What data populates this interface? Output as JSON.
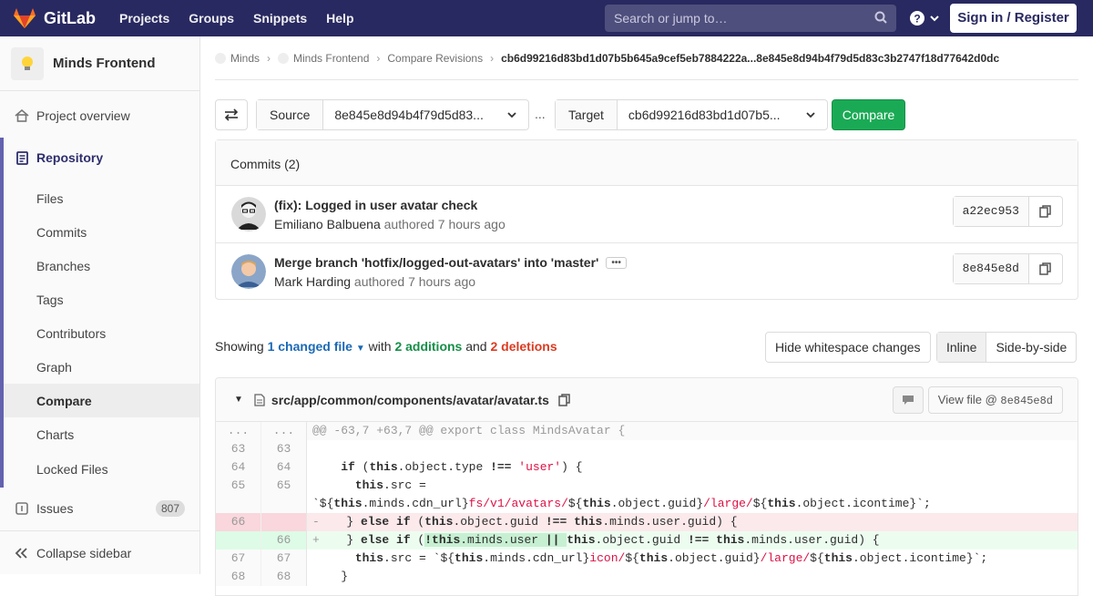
{
  "topbar": {
    "brand": "GitLab",
    "nav": [
      "Projects",
      "Groups",
      "Snippets",
      "Help"
    ],
    "search_placeholder": "Search or jump to…",
    "signin": "Sign in / Register",
    "colors": {
      "bar": "#292961"
    }
  },
  "sidebar": {
    "project": "Minds Frontend",
    "overview": "Project overview",
    "repository": "Repository",
    "repo_items": [
      "Files",
      "Commits",
      "Branches",
      "Tags",
      "Contributors",
      "Graph",
      "Compare",
      "Charts",
      "Locked Files"
    ],
    "active_item": "Compare",
    "issues": "Issues",
    "issues_count": "807",
    "collapse": "Collapse sidebar"
  },
  "breadcrumb": {
    "group": "Minds",
    "project": "Minds Frontend",
    "section": "Compare Revisions",
    "current": "cb6d99216d83bd1d07b5b645a9cef5eb7884222a...8e845e8d94b4f79d5d83c3b2747f18d77642d0dc"
  },
  "compare": {
    "source_label": "Source",
    "source_value": "8e845e8d94b4f79d5d83...",
    "ellipsis": "...",
    "target_label": "Target",
    "target_value": "cb6d99216d83bd1d07b5...",
    "button": "Compare"
  },
  "commits": {
    "header": "Commits (2)",
    "list": [
      {
        "title": "(fix): Logged in user avatar check",
        "author": "Emiliano Balbuena",
        "meta": "authored 7 hours ago",
        "sha": "a22ec953"
      },
      {
        "title": "Merge branch 'hotfix/logged-out-avatars' into 'master'",
        "author": "Mark Harding",
        "meta": "authored 7 hours ago",
        "sha": "8e845e8d"
      }
    ]
  },
  "summary": {
    "showing": "Showing",
    "changed": "1 changed file",
    "with": "with",
    "additions": "2 additions",
    "and": "and",
    "deletions": "2 deletions",
    "whitespace": "Hide whitespace changes",
    "inline": "Inline",
    "side": "Side-by-side"
  },
  "file": {
    "path": "src/app/common/components/avatar/avatar.ts",
    "view_file": "View file @",
    "view_sha": "8e845e8d",
    "hunk": "@@ -63,7 +63,7 @@ export class MindsAvatar {",
    "dots": "..."
  }
}
